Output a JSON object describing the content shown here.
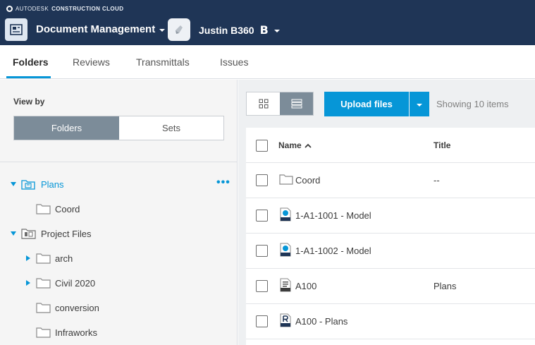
{
  "topbar": {
    "brand_prefix": "AUTODESK",
    "brand_product": "CONSTRUCTION CLOUD",
    "module_title": "Document Management",
    "project_name": "Justin B360",
    "project_mark": "B"
  },
  "tabs": [
    {
      "label": "Folders",
      "active": true
    },
    {
      "label": "Reviews",
      "active": false
    },
    {
      "label": "Transmittals",
      "active": false
    },
    {
      "label": "Issues",
      "active": false
    }
  ],
  "left_panel": {
    "view_by_label": "View by",
    "view_by_options": [
      "Folders",
      "Sets"
    ],
    "view_by_selected": "Folders",
    "tree": [
      {
        "label": "Plans",
        "icon": "plans-folder-icon",
        "expanded": true,
        "selected": true,
        "more": "•••"
      },
      {
        "label": "Coord",
        "icon": "folder-icon"
      },
      {
        "label": "Project Files",
        "icon": "project-files-folder-icon",
        "expanded": true
      },
      {
        "label": "arch",
        "icon": "folder-icon",
        "expandable": true
      },
      {
        "label": "Civil 2020",
        "icon": "folder-icon",
        "expandable": true
      },
      {
        "label": "conversion",
        "icon": "folder-icon"
      },
      {
        "label": "Infraworks",
        "icon": "folder-icon"
      }
    ]
  },
  "right_panel": {
    "upload_label": "Upload files",
    "showing_text": "Showing 10 items",
    "columns": {
      "name": "Name",
      "title": "Title"
    },
    "rows": [
      {
        "name": "Coord",
        "title": "--",
        "icon": "folder-icon"
      },
      {
        "name": "1-A1-1001 - Model",
        "title": "",
        "icon": "dwf-file-icon"
      },
      {
        "name": "1-A1-1002 - Model",
        "title": "",
        "icon": "dwf-file-icon"
      },
      {
        "name": "A100",
        "title": "Plans",
        "icon": "pdf-file-icon"
      },
      {
        "name": "A100 - Plans",
        "title": "",
        "icon": "rvt-file-icon"
      }
    ]
  },
  "colors": {
    "topbar_bg": "#1f3556",
    "accent": "#0696d7",
    "segment_selected": "#7c8c99"
  }
}
